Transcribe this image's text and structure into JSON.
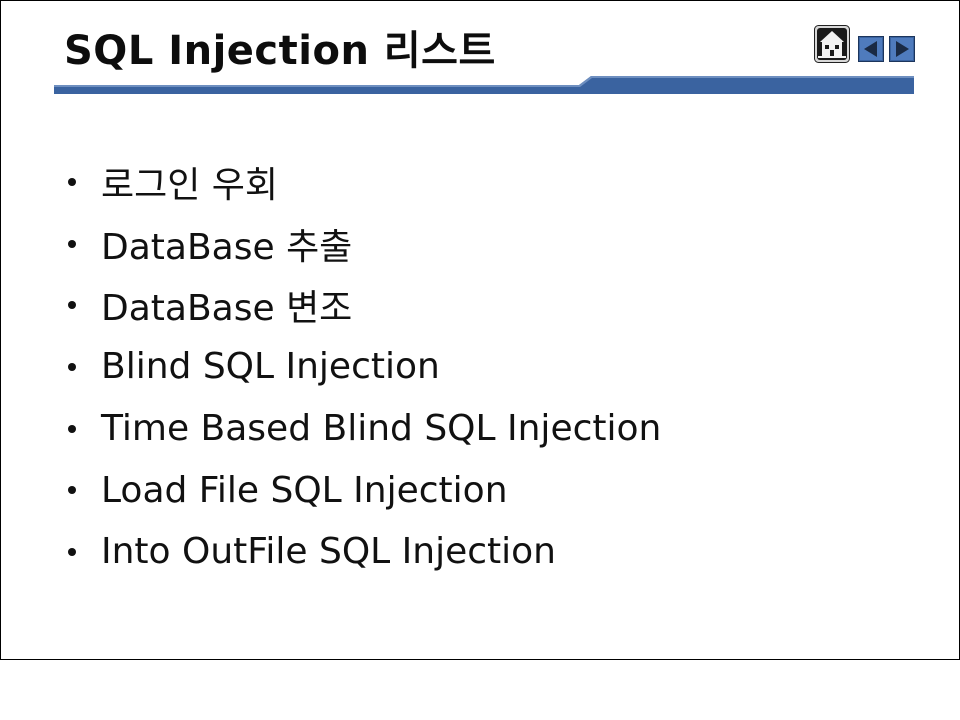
{
  "slide": {
    "title": "SQL Injection 리스트",
    "accent_color": "#3a63a0",
    "nav": {
      "home_icon": "haunted-house-icon",
      "prev_icon": "triangle-left-icon",
      "next_icon": "triangle-right-icon"
    },
    "bullets": [
      "로그인 우회",
      "DataBase 추출",
      "DataBase 변조",
      "Blind SQL Injection",
      "Time Based Blind SQL Injection",
      "Load File SQL Injection",
      "Into OutFile SQL Injection"
    ]
  }
}
